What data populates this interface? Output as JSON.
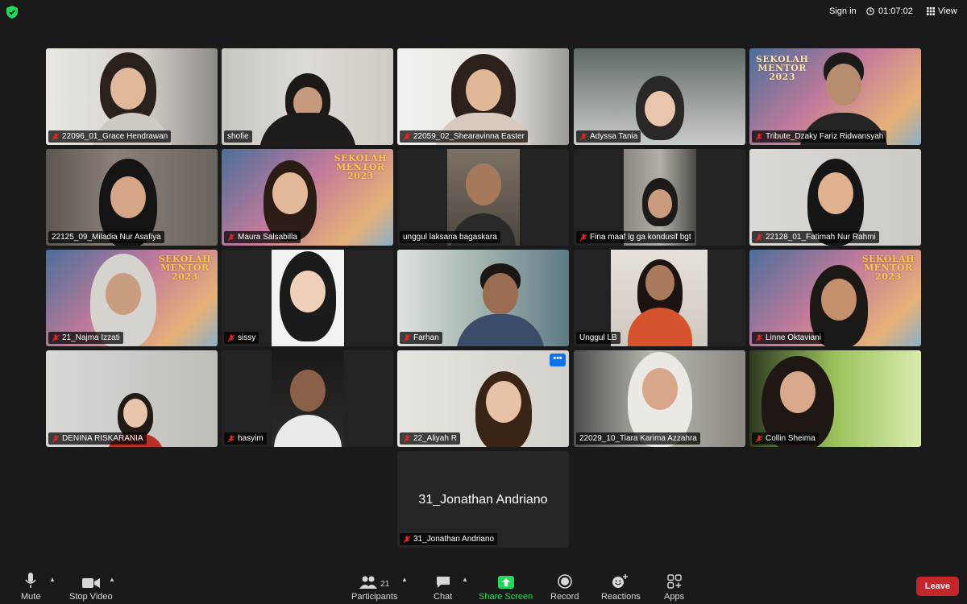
{
  "header": {
    "sign_in": "Sign in",
    "timer": "01:07:02",
    "view": "View",
    "security_color": "#23d959"
  },
  "participants": [
    {
      "name": "22096_01_Grace Hendrawan",
      "muted": true
    },
    {
      "name": "shofie",
      "muted": false,
      "active_speaker": true
    },
    {
      "name": "22059_02_Shearavinna Easter",
      "muted": true
    },
    {
      "name": "Adyssa Tania",
      "muted": true
    },
    {
      "name": "Tribute_Dzaky Fariz Ridwansyah",
      "muted": true
    },
    {
      "name": "22125_09_Miladia Nur Asafiya",
      "muted": false
    },
    {
      "name": "Maura Salsabilla",
      "muted": true
    },
    {
      "name": "unggul laksana bagaskara",
      "muted": false
    },
    {
      "name": "Fina maaf lg ga kondusif bgt",
      "muted": true
    },
    {
      "name": "22128_01_Fatimah Nur Rahmi",
      "muted": true
    },
    {
      "name": "21_Najma Izzati",
      "muted": true
    },
    {
      "name": "sissy",
      "muted": true
    },
    {
      "name": "Farhan",
      "muted": true
    },
    {
      "name": "Unggul LB",
      "muted": false
    },
    {
      "name": "Linne Oktaviani",
      "muted": true
    },
    {
      "name": "DENINA RISKARANIA",
      "muted": true
    },
    {
      "name": "hasyim",
      "muted": true
    },
    {
      "name": "22_Aliyah R",
      "muted": true
    },
    {
      "name": "22029_10_Tiara Karima Azzahra",
      "muted": false
    },
    {
      "name": "Collin Sheima",
      "muted": true
    },
    {
      "name": "31_Jonathan Andriano",
      "muted": true,
      "video_off": true
    }
  ],
  "banner": {
    "line1": "SEKOLAH",
    "line2": "MENTOR",
    "line3": "2023"
  },
  "more_button": "•••",
  "toolbar": {
    "mute": "Mute",
    "stop_video": "Stop Video",
    "participants": "Participants",
    "participants_count": "21",
    "chat": "Chat",
    "share_screen": "Share Screen",
    "record": "Record",
    "reactions": "Reactions",
    "apps": "Apps",
    "leave": "Leave",
    "share_color": "#23d959",
    "leave_color": "#c3252b"
  }
}
